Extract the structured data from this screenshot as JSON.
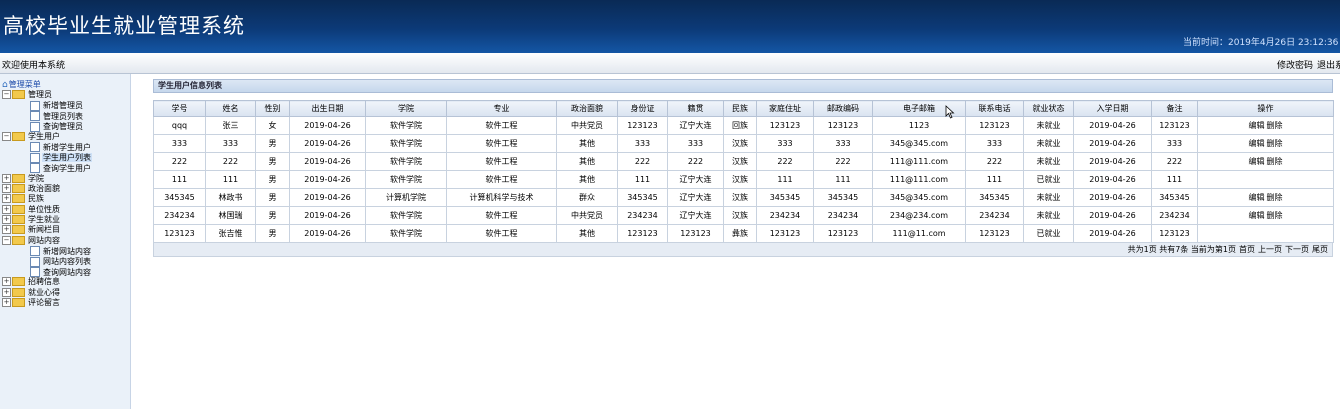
{
  "header": {
    "title": "高校毕业生就业管理系统",
    "clock": "当前时间：2019年4月26日 23:12:36 星期"
  },
  "bar": {
    "welcome": "欢迎使用本系统",
    "change_password": "修改密码",
    "logout": "退出系"
  },
  "sidebar": {
    "root": "管理菜单",
    "nodes": [
      {
        "label": "管理员",
        "type": "folder",
        "expand": "-"
      },
      {
        "label": "新增管理员",
        "type": "page"
      },
      {
        "label": "管理员列表",
        "type": "page"
      },
      {
        "label": "查询管理员",
        "type": "page"
      },
      {
        "label": "学生用户",
        "type": "folder",
        "expand": "-"
      },
      {
        "label": "新增学生用户",
        "type": "page"
      },
      {
        "label": "学生用户列表",
        "type": "page",
        "selected": true
      },
      {
        "label": "查询学生用户",
        "type": "page"
      },
      {
        "label": "学院",
        "type": "folder",
        "expand": "+"
      },
      {
        "label": "政治面貌",
        "type": "folder",
        "expand": "+"
      },
      {
        "label": "民族",
        "type": "folder",
        "expand": "+"
      },
      {
        "label": "单位性质",
        "type": "folder",
        "expand": "+"
      },
      {
        "label": "学生就业",
        "type": "folder",
        "expand": "+"
      },
      {
        "label": "新闻栏目",
        "type": "folder",
        "expand": "+"
      },
      {
        "label": "网站内容",
        "type": "folder",
        "expand": "-"
      },
      {
        "label": "新增网站内容",
        "type": "page"
      },
      {
        "label": "网站内容列表",
        "type": "page"
      },
      {
        "label": "查询网站内容",
        "type": "page"
      },
      {
        "label": "招聘信息",
        "type": "folder",
        "expand": "+"
      },
      {
        "label": "就业心得",
        "type": "folder",
        "expand": "+"
      },
      {
        "label": "评论留言",
        "type": "folder",
        "expand": "+"
      }
    ]
  },
  "panel": {
    "title": "学生用户信息列表"
  },
  "table": {
    "columns": [
      "学号",
      "姓名",
      "性别",
      "出生日期",
      "学院",
      "专业",
      "政治面貌",
      "身份证",
      "籍贯",
      "民族",
      "家庭住址",
      "邮政编码",
      "电子邮箱",
      "联系电话",
      "就业状态",
      "入学日期",
      "备注",
      "操作"
    ],
    "rows": [
      [
        "qqq",
        "张三",
        "女",
        "2019-04-26",
        "软件学院",
        "软件工程",
        "中共党员",
        "123123",
        "辽宁大连",
        "回族",
        "123123",
        "123123",
        "1123",
        "123123",
        "未就业",
        "2019-04-26",
        "123123"
      ],
      [
        "333",
        "333",
        "男",
        "2019-04-26",
        "软件学院",
        "软件工程",
        "其他",
        "333",
        "333",
        "汉族",
        "333",
        "333",
        "345@345.com",
        "333",
        "未就业",
        "2019-04-26",
        "333"
      ],
      [
        "222",
        "222",
        "男",
        "2019-04-26",
        "软件学院",
        "软件工程",
        "其他",
        "222",
        "222",
        "汉族",
        "222",
        "222",
        "111@111.com",
        "222",
        "未就业",
        "2019-04-26",
        "222"
      ],
      [
        "111",
        "111",
        "男",
        "2019-04-26",
        "软件学院",
        "软件工程",
        "其他",
        "111",
        "辽宁大连",
        "汉族",
        "111",
        "111",
        "111@111.com",
        "111",
        "已就业",
        "2019-04-26",
        "111"
      ],
      [
        "345345",
        "林政书",
        "男",
        "2019-04-26",
        "计算机学院",
        "计算机科学与技术",
        "群众",
        "345345",
        "辽宁大连",
        "汉族",
        "345345",
        "345345",
        "345@345.com",
        "345345",
        "未就业",
        "2019-04-26",
        "345345"
      ],
      [
        "234234",
        "林国瑞",
        "男",
        "2019-04-26",
        "软件学院",
        "软件工程",
        "中共党员",
        "234234",
        "辽宁大连",
        "汉族",
        "234234",
        "234234",
        "234@234.com",
        "234234",
        "未就业",
        "2019-04-26",
        "234234"
      ],
      [
        "123123",
        "张吉惟",
        "男",
        "2019-04-26",
        "软件学院",
        "软件工程",
        "其他",
        "123123",
        "123123",
        "彝族",
        "123123",
        "123123",
        "111@11.com",
        "123123",
        "已就业",
        "2019-04-26",
        "123123"
      ]
    ],
    "row_actions": [
      true,
      true,
      true,
      false,
      true,
      true,
      false
    ],
    "edit_label": "编辑",
    "delete_label": "删除"
  },
  "pager": {
    "summary": "共为1页 共有7条 当前为第1页",
    "first": "首页",
    "prev": "上一页",
    "next": "下一页",
    "last": "尾页"
  }
}
